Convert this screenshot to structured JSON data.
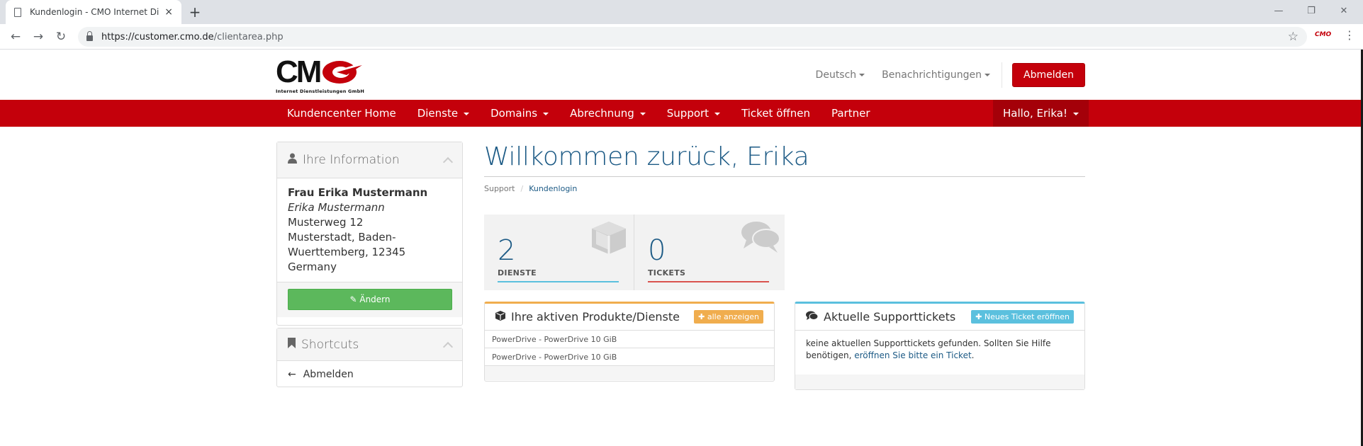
{
  "browser": {
    "tab_title": "Kundenlogin - CMO Internet Die",
    "tab_close": "×",
    "new_tab": "+",
    "window_controls": [
      "—",
      "❐",
      "✕"
    ],
    "url_host": "https://customer.cmo.de",
    "url_path": "/clientarea.php",
    "extension_label": "CMO"
  },
  "header": {
    "logo_text": "CM",
    "logo_subtitle": "Internet Dienstleistungen GmbH",
    "language": "Deutsch",
    "notifications": "Benachrichtigungen",
    "logout_button": "Abmelden"
  },
  "nav": {
    "items": [
      {
        "label": "Kundencenter Home",
        "dropdown": false
      },
      {
        "label": "Dienste",
        "dropdown": true
      },
      {
        "label": "Domains",
        "dropdown": true
      },
      {
        "label": "Abrechnung",
        "dropdown": true
      },
      {
        "label": "Support",
        "dropdown": true
      },
      {
        "label": "Ticket öffnen",
        "dropdown": false
      },
      {
        "label": "Partner",
        "dropdown": false
      }
    ],
    "user_menu": "Hallo, Erika!"
  },
  "sidebar": {
    "info_title": "Ihre Information",
    "name": "Frau Erika Mustermann",
    "company": "Erika Mustermann",
    "street": "Musterweg 12",
    "city_line1": "Musterstadt, Baden-",
    "city_line2": "Wuerttemberg, 12345",
    "country": "Germany",
    "edit_button": "Ändern",
    "shortcuts_title": "Shortcuts",
    "shortcut_logout": "Abmelden"
  },
  "main": {
    "welcome": "Willkommen zurück, Erika",
    "breadcrumb": [
      "Support",
      "Kundenlogin"
    ],
    "tiles": [
      {
        "value": "2",
        "label": "DIENSTE",
        "color": "#5bc0de"
      },
      {
        "value": "0",
        "label": "TICKETS",
        "color": "#d9534f"
      }
    ],
    "products": {
      "title": "Ihre aktiven Produkte/Dienste",
      "button": "alle anzeigen",
      "rows": [
        "PowerDrive - PowerDrive 10 GiB",
        "PowerDrive - PowerDrive 10 GiB"
      ]
    },
    "tickets": {
      "title": "Aktuelle Supporttickets",
      "button": "Neues Ticket eröffnen",
      "text1": "keine aktuellen Supporttickets gefunden. Sollten Sie Hilfe benötigen, ",
      "link": "eröffnen Sie bitte ein Ticket",
      "text2": "."
    }
  },
  "colors": {
    "brand_red": "#c4000b",
    "link_blue": "#1c5a85",
    "success_green": "#5cb85c",
    "warning_orange": "#f0ad4e",
    "info_cyan": "#5bc0de"
  }
}
